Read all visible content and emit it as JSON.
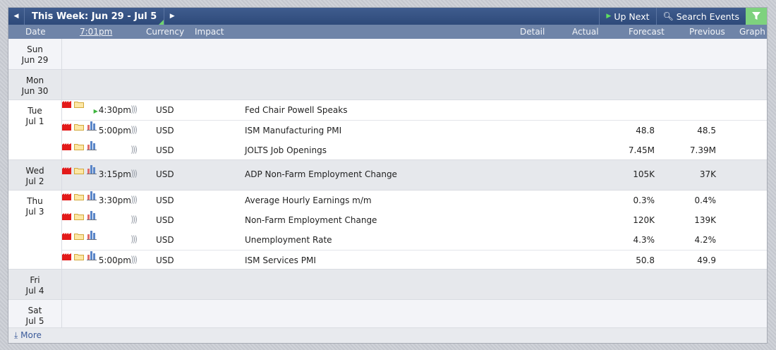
{
  "topbar": {
    "week_label": "This Week: Jun 29 - Jul 5",
    "up_next": "Up Next",
    "search_events": "Search Events"
  },
  "columns": {
    "date": "Date",
    "time": "7:01pm",
    "currency": "Currency",
    "impact": "Impact",
    "detail": "Detail",
    "actual": "Actual",
    "forecast": "Forecast",
    "previous": "Previous",
    "graph": "Graph"
  },
  "days": [
    {
      "dow": "Sun",
      "date": "Jun 29"
    },
    {
      "dow": "Mon",
      "date": "Jun 30"
    },
    {
      "dow": "Tue",
      "date": "Jul 1"
    },
    {
      "dow": "Wed",
      "date": "Jul 2"
    },
    {
      "dow": "Thu",
      "date": "Jul 3"
    },
    {
      "dow": "Fri",
      "date": "Jul 4"
    },
    {
      "dow": "Sat",
      "date": "Jul 5"
    }
  ],
  "events": [
    {
      "time": "4:30pm",
      "currency": "USD",
      "name": "Fed Chair Powell Speaks",
      "forecast": "",
      "previous": ""
    },
    {
      "time": "5:00pm",
      "currency": "USD",
      "name": "ISM Manufacturing PMI",
      "forecast": "48.8",
      "previous": "48.5"
    },
    {
      "time": "",
      "currency": "USD",
      "name": "JOLTS Job Openings",
      "forecast": "7.45M",
      "previous": "7.39M"
    },
    {
      "time": "3:15pm",
      "currency": "USD",
      "name": "ADP Non-Farm Employment Change",
      "forecast": "105K",
      "previous": "37K"
    },
    {
      "time": "3:30pm",
      "currency": "USD",
      "name": "Average Hourly Earnings m/m",
      "forecast": "0.3%",
      "previous": "0.4%"
    },
    {
      "time": "",
      "currency": "USD",
      "name": "Non-Farm Employment Change",
      "forecast": "120K",
      "previous": "139K"
    },
    {
      "time": "",
      "currency": "USD",
      "name": "Unemployment Rate",
      "forecast": "4.3%",
      "previous": "4.2%"
    },
    {
      "time": "5:00pm",
      "currency": "USD",
      "name": "ISM Services PMI",
      "forecast": "50.8",
      "previous": "49.9"
    }
  ],
  "footer": {
    "more": "More"
  },
  "colors": {
    "header": "#2e4a7a",
    "impact_high": "#e31a1a",
    "filter": "#7ed27e"
  }
}
